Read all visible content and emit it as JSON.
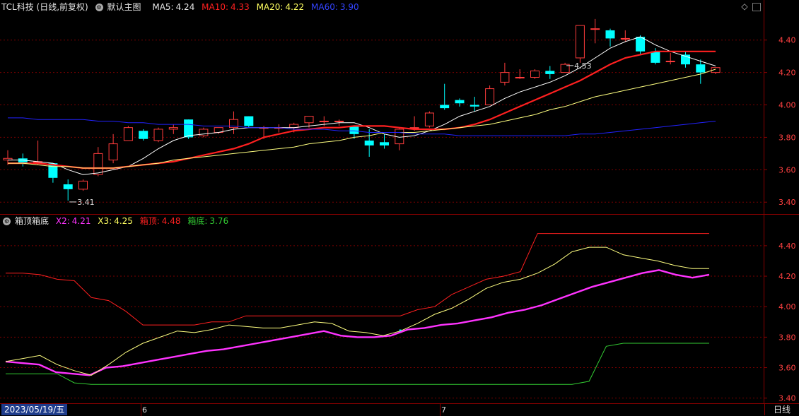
{
  "stock_header": {
    "title": "TCL科技 (日线,前复权)",
    "template": "默认主图",
    "ma5_label": "MA5:",
    "ma5_value": "4.24",
    "ma10_label": "MA10:",
    "ma10_value": "4.33",
    "ma20_label": "MA20:",
    "ma20_value": "4.22",
    "ma60_label": "MA60:",
    "ma60_value": "3.90"
  },
  "indicator_header": {
    "name": "箱顶箱底",
    "x2_label": "X2:",
    "x2_value": "4.21",
    "x3_label": "X3:",
    "x3_value": "4.25",
    "top_label": "箱顶:",
    "top_value": "4.48",
    "bottom_label": "箱底:",
    "bottom_value": "3.76"
  },
  "colors": {
    "up": "#ff3c3c",
    "down": "#00ffff",
    "ma5": "#ffffff",
    "ma10": "#ff2020",
    "ma20": "#ffff80",
    "ma60": "#2222ff",
    "grid": "#7a0000",
    "axis": "#8b0000",
    "x2": "#ff33ff",
    "x3": "#ffff80",
    "box_top": "#ff2020",
    "box_bottom": "#33cc33"
  },
  "footer": {
    "date": "2023/05/19/五",
    "period": "日线",
    "month_labels": [
      "6",
      "7"
    ]
  },
  "chart_data": [
    {
      "type": "candlestick",
      "ylim": [
        3.34,
        4.56
      ],
      "y_ticks": [
        "3.40",
        "3.60",
        "3.80",
        "4.00",
        "4.20",
        "4.40"
      ],
      "annotations": [
        {
          "text": "4.53",
          "bar": 37
        },
        {
          "text": "3.41",
          "bar": 4
        }
      ],
      "ohlc": [
        [
          3.66,
          3.67,
          3.72,
          3.63
        ],
        [
          3.67,
          3.64,
          3.7,
          3.62
        ],
        [
          3.65,
          3.65,
          3.78,
          3.63
        ],
        [
          3.64,
          3.55,
          3.64,
          3.52
        ],
        [
          3.51,
          3.48,
          3.54,
          3.41
        ],
        [
          3.48,
          3.53,
          3.54,
          3.47
        ],
        [
          3.57,
          3.7,
          3.74,
          3.56
        ],
        [
          3.66,
          3.76,
          3.82,
          3.64
        ],
        [
          3.78,
          3.86,
          3.87,
          3.78
        ],
        [
          3.84,
          3.79,
          3.85,
          3.78
        ],
        [
          3.78,
          3.85,
          3.86,
          3.77
        ],
        [
          3.85,
          3.86,
          3.88,
          3.82
        ],
        [
          3.91,
          3.8,
          3.91,
          3.79
        ],
        [
          3.81,
          3.85,
          3.86,
          3.8
        ],
        [
          3.83,
          3.86,
          3.86,
          3.82
        ],
        [
          3.86,
          3.91,
          3.96,
          3.82
        ],
        [
          3.93,
          3.87,
          3.93,
          3.86
        ],
        [
          3.86,
          3.86,
          3.87,
          3.79
        ],
        [
          3.86,
          3.86,
          3.88,
          3.83
        ],
        [
          3.86,
          3.88,
          3.89,
          3.83
        ],
        [
          3.89,
          3.93,
          3.93,
          3.86
        ],
        [
          3.9,
          3.9,
          3.93,
          3.87
        ],
        [
          3.9,
          3.9,
          3.91,
          3.87
        ],
        [
          3.87,
          3.82,
          3.87,
          3.79
        ],
        [
          3.78,
          3.75,
          3.85,
          3.68
        ],
        [
          3.77,
          3.75,
          3.82,
          3.73
        ],
        [
          3.76,
          3.85,
          3.86,
          3.72
        ],
        [
          3.86,
          3.86,
          3.93,
          3.84
        ],
        [
          3.87,
          3.95,
          3.96,
          3.86
        ],
        [
          4.0,
          3.98,
          4.13,
          3.97
        ],
        [
          4.03,
          4.01,
          4.04,
          3.99
        ],
        [
          4.0,
          3.99,
          4.05,
          3.96
        ],
        [
          4.0,
          4.1,
          4.12,
          4.0
        ],
        [
          4.14,
          4.2,
          4.26,
          4.12
        ],
        [
          4.17,
          4.17,
          4.22,
          4.16
        ],
        [
          4.17,
          4.21,
          4.22,
          4.16
        ],
        [
          4.21,
          4.19,
          4.24,
          4.16
        ],
        [
          4.2,
          4.25,
          4.26,
          4.2
        ],
        [
          4.29,
          4.49,
          4.49,
          4.26
        ],
        [
          4.47,
          4.47,
          4.53,
          4.38
        ],
        [
          4.46,
          4.41,
          4.47,
          4.36
        ],
        [
          4.41,
          4.41,
          4.46,
          4.39
        ],
        [
          4.42,
          4.33,
          4.43,
          4.31
        ],
        [
          4.33,
          4.26,
          4.35,
          4.25
        ],
        [
          4.27,
          4.27,
          4.32,
          4.25
        ],
        [
          4.31,
          4.25,
          4.33,
          4.23
        ],
        [
          4.25,
          4.2,
          4.28,
          4.13
        ],
        [
          4.2,
          4.23,
          4.23,
          4.19
        ]
      ],
      "series": [
        {
          "name": "MA5",
          "values": [
            3.66,
            3.66,
            3.65,
            3.64,
            3.6,
            3.57,
            3.58,
            3.6,
            3.62,
            3.67,
            3.73,
            3.78,
            3.81,
            3.82,
            3.83,
            3.85,
            3.86,
            3.86,
            3.86,
            3.86,
            3.87,
            3.88,
            3.89,
            3.89,
            3.86,
            3.82,
            3.8,
            3.81,
            3.84,
            3.88,
            3.93,
            3.96,
            3.99,
            4.04,
            4.08,
            4.11,
            4.14,
            4.18,
            4.23,
            4.29,
            4.35,
            4.39,
            4.42,
            4.37,
            4.33,
            4.3,
            4.27,
            4.24
          ]
        },
        {
          "name": "MA10",
          "values": [
            3.64,
            3.64,
            3.64,
            3.63,
            3.62,
            3.61,
            3.61,
            3.61,
            3.62,
            3.63,
            3.64,
            3.65,
            3.67,
            3.69,
            3.71,
            3.73,
            3.76,
            3.8,
            3.82,
            3.84,
            3.85,
            3.86,
            3.86,
            3.87,
            3.87,
            3.87,
            3.86,
            3.85,
            3.85,
            3.85,
            3.86,
            3.88,
            3.91,
            3.95,
            3.99,
            4.03,
            4.07,
            4.11,
            4.15,
            4.2,
            4.25,
            4.29,
            4.31,
            4.33,
            4.33,
            4.33,
            4.33,
            4.33
          ]
        },
        {
          "name": "MA20",
          "values": [
            3.64,
            3.64,
            3.63,
            3.62,
            3.62,
            3.61,
            3.61,
            3.61,
            3.62,
            3.63,
            3.64,
            3.66,
            3.67,
            3.68,
            3.69,
            3.7,
            3.71,
            3.72,
            3.73,
            3.74,
            3.76,
            3.77,
            3.78,
            3.8,
            3.81,
            3.83,
            3.83,
            3.83,
            3.84,
            3.85,
            3.86,
            3.87,
            3.88,
            3.9,
            3.92,
            3.94,
            3.97,
            3.99,
            4.02,
            4.05,
            4.07,
            4.09,
            4.11,
            4.13,
            4.15,
            4.17,
            4.19,
            4.22
          ]
        },
        {
          "name": "MA60",
          "values": [
            3.92,
            3.92,
            3.91,
            3.91,
            3.91,
            3.91,
            3.9,
            3.9,
            3.89,
            3.89,
            3.88,
            3.88,
            3.88,
            3.87,
            3.87,
            3.87,
            3.86,
            3.86,
            3.86,
            3.85,
            3.85,
            3.85,
            3.84,
            3.84,
            3.83,
            3.83,
            3.83,
            3.82,
            3.82,
            3.82,
            3.81,
            3.81,
            3.81,
            3.81,
            3.81,
            3.81,
            3.81,
            3.81,
            3.82,
            3.82,
            3.83,
            3.84,
            3.85,
            3.86,
            3.87,
            3.88,
            3.89,
            3.9
          ]
        }
      ]
    },
    {
      "type": "line",
      "ylim": [
        3.38,
        4.52
      ],
      "y_ticks": [
        "3.40",
        "3.60",
        "3.80",
        "4.00",
        "4.20",
        "4.40"
      ],
      "series": [
        {
          "name": "X2",
          "values": [
            3.64,
            3.63,
            3.62,
            3.57,
            3.56,
            3.55,
            3.6,
            3.61,
            3.63,
            3.65,
            3.67,
            3.69,
            3.71,
            3.72,
            3.74,
            3.76,
            3.78,
            3.8,
            3.82,
            3.84,
            3.81,
            3.8,
            3.8,
            3.81,
            3.85,
            3.86,
            3.88,
            3.89,
            3.91,
            3.93,
            3.96,
            3.98,
            4.01,
            4.05,
            4.09,
            4.13,
            4.16,
            4.19,
            4.22,
            4.24,
            4.21,
            4.19,
            4.21
          ]
        },
        {
          "name": "X3",
          "values": [
            3.64,
            3.66,
            3.68,
            3.62,
            3.58,
            3.55,
            3.62,
            3.7,
            3.76,
            3.8,
            3.84,
            3.83,
            3.85,
            3.88,
            3.87,
            3.86,
            3.86,
            3.88,
            3.9,
            3.89,
            3.84,
            3.83,
            3.81,
            3.84,
            3.89,
            3.95,
            3.99,
            4.05,
            4.12,
            4.16,
            4.18,
            4.22,
            4.28,
            4.36,
            4.39,
            4.39,
            4.34,
            4.32,
            4.3,
            4.27,
            4.25,
            4.25
          ]
        },
        {
          "name": "箱顶",
          "values": [
            4.22,
            4.22,
            4.21,
            4.18,
            4.17,
            4.06,
            4.04,
            3.97,
            3.88,
            3.88,
            3.88,
            3.88,
            3.9,
            3.9,
            3.94,
            3.94,
            3.94,
            3.94,
            3.94,
            3.94,
            3.94,
            3.94,
            3.94,
            3.94,
            3.98,
            4.0,
            4.08,
            4.13,
            4.18,
            4.2,
            4.23,
            4.48,
            4.48,
            4.48,
            4.48,
            4.48,
            4.48,
            4.48,
            4.48,
            4.48,
            4.48,
            4.48
          ]
        },
        {
          "name": "箱底",
          "values": [
            3.56,
            3.56,
            3.56,
            3.56,
            3.5,
            3.49,
            3.49,
            3.49,
            3.49,
            3.49,
            3.49,
            3.49,
            3.49,
            3.49,
            3.49,
            3.49,
            3.49,
            3.49,
            3.49,
            3.49,
            3.49,
            3.49,
            3.49,
            3.49,
            3.49,
            3.49,
            3.49,
            3.49,
            3.49,
            3.49,
            3.49,
            3.49,
            3.49,
            3.49,
            3.51,
            3.74,
            3.76,
            3.76,
            3.76,
            3.76,
            3.76,
            3.76
          ]
        }
      ]
    }
  ]
}
